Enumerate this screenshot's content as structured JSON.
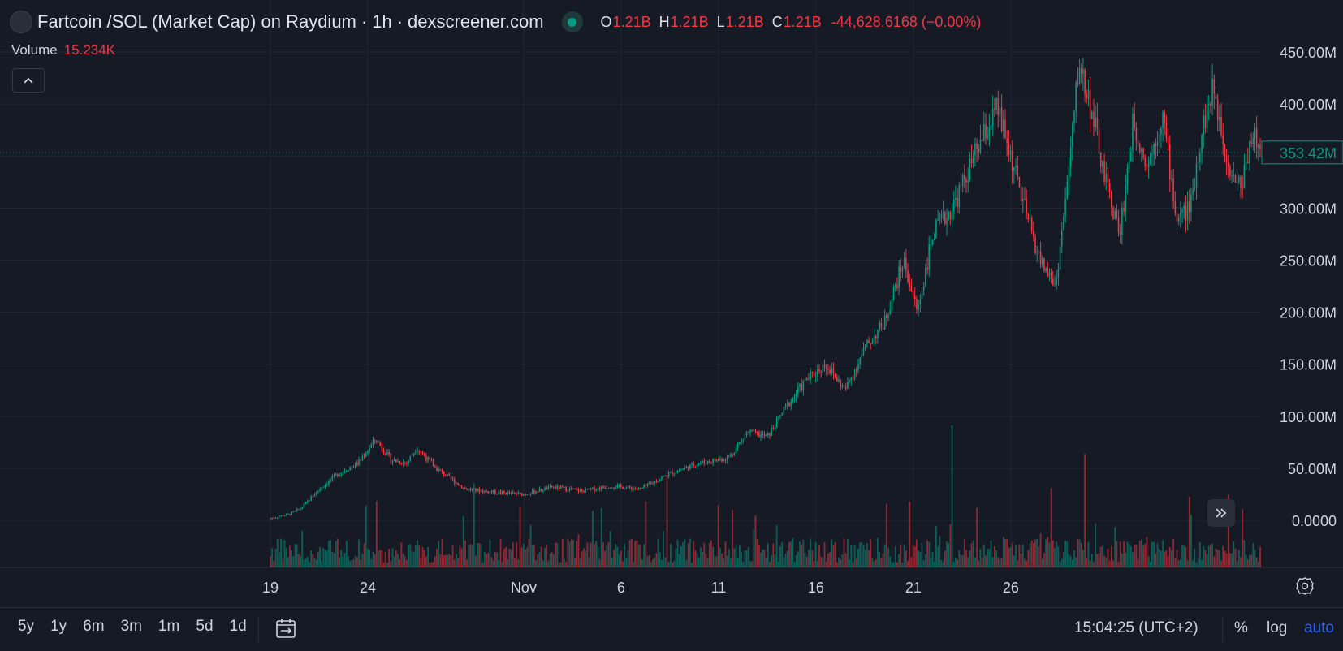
{
  "header": {
    "symbol": "Fartcoin /SOL (Market Cap) on Raydium",
    "interval": "1h",
    "source": "dexscreener.com",
    "ohlc": {
      "o_label": "O",
      "o": "1.21B",
      "h_label": "H",
      "h": "1.21B",
      "l_label": "L",
      "l": "1.21B",
      "c_label": "C",
      "c": "1.21B",
      "change": "-44,628.6168 (−0.00%)"
    },
    "volume_label": "Volume",
    "volume_value": "15.234K"
  },
  "toolbar": {
    "ranges": [
      "5y",
      "1y",
      "6m",
      "3m",
      "1m",
      "5d",
      "1d"
    ],
    "clock": "15:04:25 (UTC+2)",
    "percent_label": "%",
    "log_label": "log",
    "auto_label": "auto"
  },
  "colors": {
    "up": "#089981",
    "down": "#f23645",
    "background": "#161a25",
    "grid": "#232734",
    "accent": "#2962ff"
  },
  "icons": {
    "collapse": "chevron-up-icon",
    "scroll": "double-chevron-right-icon",
    "settings": "gear-icon",
    "date_range": "calendar-range-icon",
    "live": "live-status-icon"
  },
  "chart_data": {
    "type": "candlestick",
    "series": [
      {
        "name": "Market Cap",
        "points": [
          {
            "t": 0,
            "v": 2
          },
          {
            "t": 1,
            "v": 6
          },
          {
            "t": 1.6,
            "v": 12
          },
          {
            "t": 2.5,
            "v": 30
          },
          {
            "t": 3.5,
            "v": 45
          },
          {
            "t": 4.5,
            "v": 55
          },
          {
            "t": 5.4,
            "v": 78
          },
          {
            "t": 6.2,
            "v": 58
          },
          {
            "t": 7,
            "v": 55
          },
          {
            "t": 7.5,
            "v": 70
          },
          {
            "t": 8.5,
            "v": 50
          },
          {
            "t": 10,
            "v": 30
          },
          {
            "t": 11.5,
            "v": 27
          },
          {
            "t": 13,
            "v": 25
          },
          {
            "t": 14.5,
            "v": 32
          },
          {
            "t": 16,
            "v": 28
          },
          {
            "t": 17.5,
            "v": 33
          },
          {
            "t": 19,
            "v": 30
          },
          {
            "t": 20.5,
            "v": 45
          },
          {
            "t": 22,
            "v": 55
          },
          {
            "t": 23.5,
            "v": 60
          },
          {
            "t": 24.5,
            "v": 85
          },
          {
            "t": 25.5,
            "v": 80
          },
          {
            "t": 26.5,
            "v": 110
          },
          {
            "t": 27.5,
            "v": 135
          },
          {
            "t": 28.5,
            "v": 150
          },
          {
            "t": 29.5,
            "v": 125
          },
          {
            "t": 30.5,
            "v": 165
          },
          {
            "t": 31.5,
            "v": 190
          },
          {
            "t": 32.5,
            "v": 250
          },
          {
            "t": 33.2,
            "v": 200
          },
          {
            "t": 34,
            "v": 275
          },
          {
            "t": 35,
            "v": 300
          },
          {
            "t": 36.5,
            "v": 365
          },
          {
            "t": 37.3,
            "v": 395
          },
          {
            "t": 38,
            "v": 350
          },
          {
            "t": 38.7,
            "v": 300
          },
          {
            "t": 39.5,
            "v": 250
          },
          {
            "t": 40.3,
            "v": 225
          },
          {
            "t": 41,
            "v": 340
          },
          {
            "t": 41.5,
            "v": 440
          },
          {
            "t": 42.2,
            "v": 390
          },
          {
            "t": 42.8,
            "v": 330
          },
          {
            "t": 43.6,
            "v": 275
          },
          {
            "t": 44.3,
            "v": 385
          },
          {
            "t": 45,
            "v": 340
          },
          {
            "t": 45.8,
            "v": 390
          },
          {
            "t": 46.5,
            "v": 290
          },
          {
            "t": 47.2,
            "v": 300
          },
          {
            "t": 47.8,
            "v": 375
          },
          {
            "t": 48.4,
            "v": 415
          },
          {
            "t": 49.2,
            "v": 340
          },
          {
            "t": 49.8,
            "v": 320
          },
          {
            "t": 50.4,
            "v": 375
          },
          {
            "t": 50.8,
            "v": 353.42
          }
        ]
      }
    ],
    "x_tick_labels": [
      "19",
      "24",
      "Nov",
      "6",
      "11",
      "16",
      "21",
      "26"
    ],
    "y_tick_labels": [
      "450.00M",
      "400.00M",
      "350.00M",
      "300.00M",
      "250.00M",
      "200.00M",
      "150.00M",
      "100.00M",
      "50.00M",
      "0.0000"
    ],
    "ylim": [
      0,
      450
    ],
    "y_unit": "M",
    "last_price_label": "353.42M",
    "volume_series": true,
    "grid": true
  }
}
